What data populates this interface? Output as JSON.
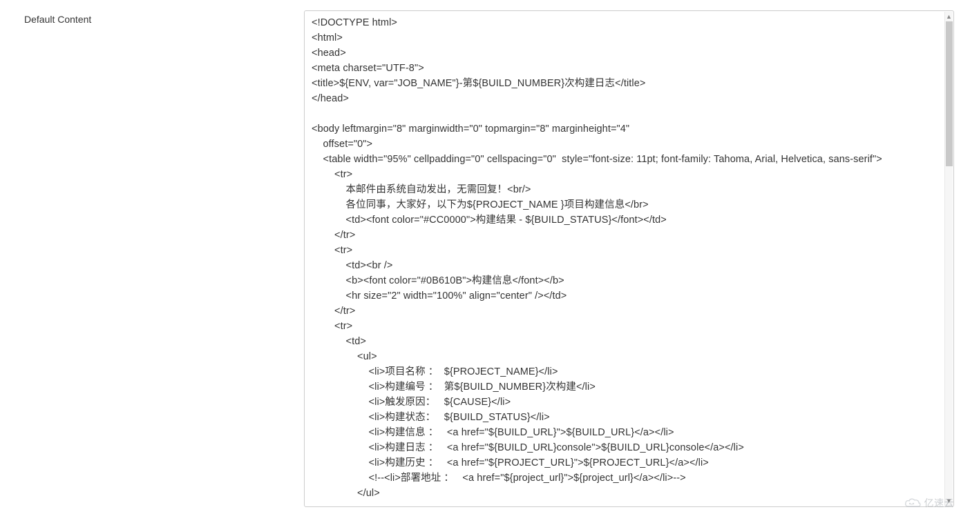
{
  "field": {
    "label": "Default Content"
  },
  "textarea": {
    "lines": [
      "<!DOCTYPE html>",
      "<html>",
      "<head>",
      "<meta charset=\"UTF-8\">",
      "<title>${ENV, var=\"JOB_NAME\"}-第${BUILD_NUMBER}次构建日志</title>",
      "</head>",
      "",
      "<body leftmargin=\"8\" marginwidth=\"0\" topmargin=\"8\" marginheight=\"4\"",
      "    offset=\"0\">",
      "    <table width=\"95%\" cellpadding=\"0\" cellspacing=\"0\"  style=\"font-size: 11pt; font-family: Tahoma, Arial, Helvetica, sans-serif\">",
      "        <tr>",
      "            本邮件由系统自动发出，无需回复！<br/>",
      "            各位同事，大家好，以下为${PROJECT_NAME }项目构建信息</br>",
      "            <td><font color=\"#CC0000\">构建结果 - ${BUILD_STATUS}</font></td>",
      "        </tr>",
      "        <tr>",
      "            <td><br />",
      "            <b><font color=\"#0B610B\">构建信息</font></b>",
      "            <hr size=\"2\" width=\"100%\" align=\"center\" /></td>",
      "        </tr>",
      "        <tr>",
      "            <td>",
      "                <ul>",
      "                    <li>项目名称 ：  ${PROJECT_NAME}</li>",
      "                    <li>构建编号 ：  第${BUILD_NUMBER}次构建</li>",
      "                    <li>触发原因：   ${CAUSE}</li>",
      "                    <li>构建状态：   ${BUILD_STATUS}</li>",
      "                    <li>构建信息 ：   <a href=\"${BUILD_URL}\">${BUILD_URL}</a></li>",
      "                    <li>构建日志 ：   <a href=\"${BUILD_URL}console\">${BUILD_URL}console</a></li>",
      "                    <li>构建历史 ：   <a href=\"${PROJECT_URL}\">${PROJECT_URL}</a></li>",
      "                    <!--<li>部署地址 ：   <a href=\"${project_url}\">${project_url}</a></li>-->",
      "                </ul>"
    ]
  },
  "watermark": {
    "text": "亿速云"
  }
}
